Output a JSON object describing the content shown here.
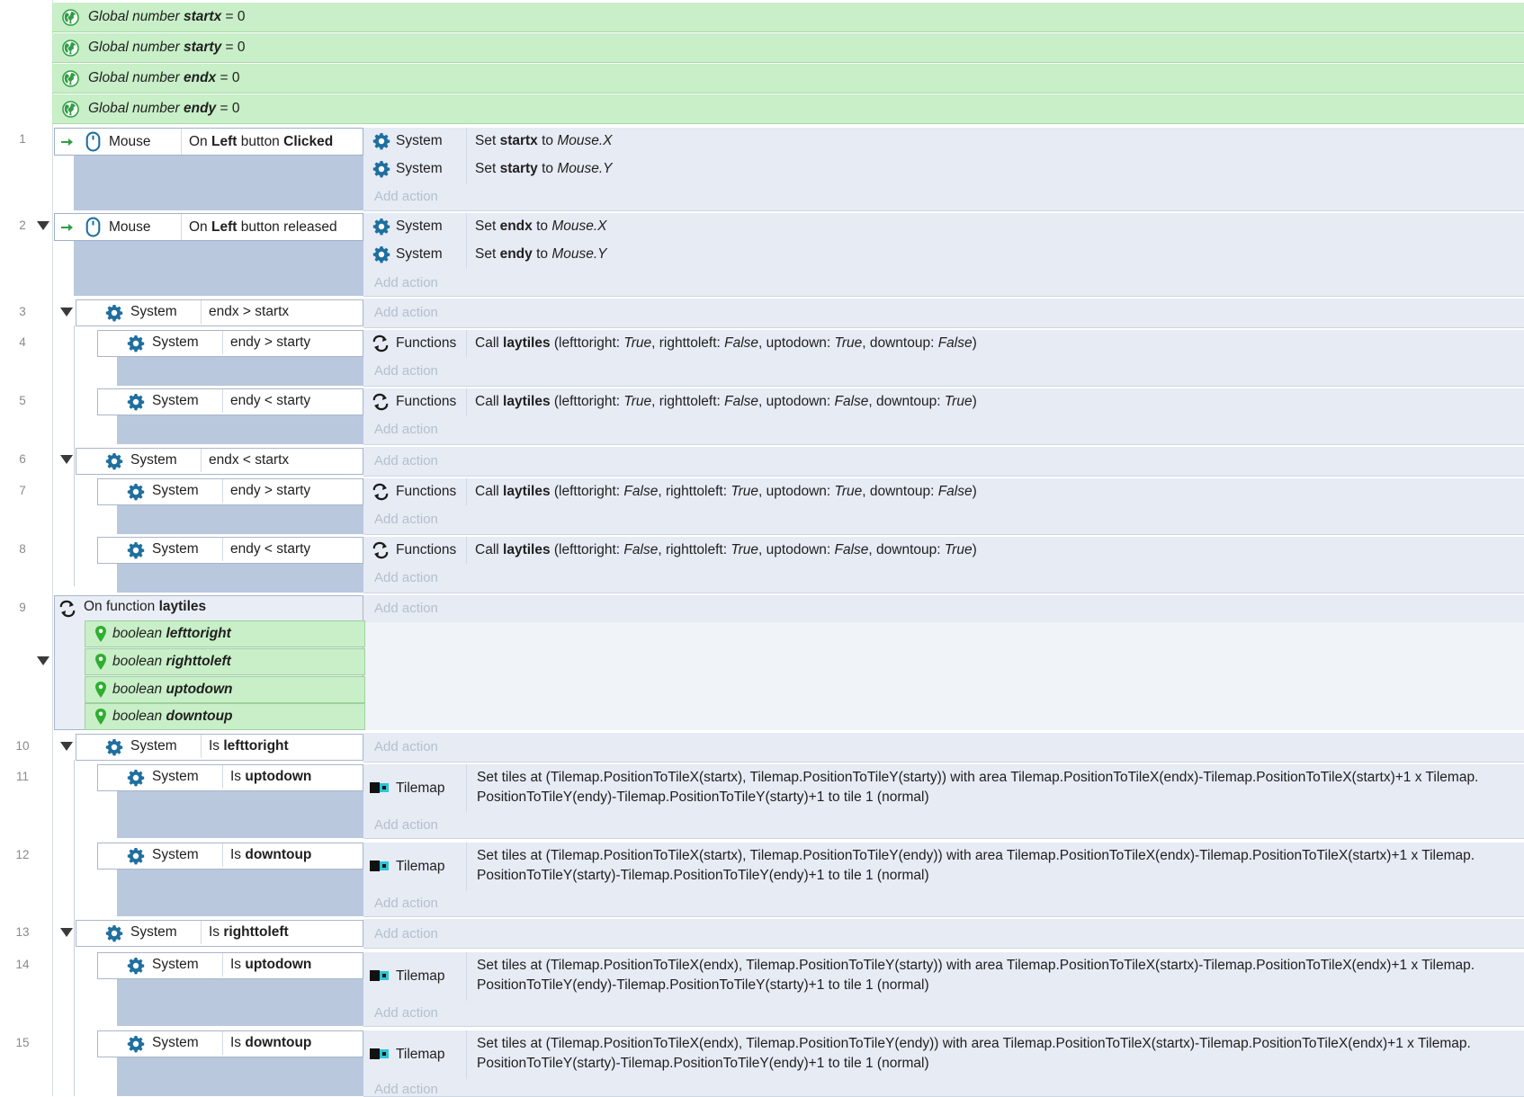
{
  "globals": [
    {
      "prefix": "Global number",
      "name": "startx",
      "value": "= 0"
    },
    {
      "prefix": "Global number",
      "name": "starty",
      "value": "= 0"
    },
    {
      "prefix": "Global number",
      "name": "endx",
      "value": "= 0"
    },
    {
      "prefix": "Global number",
      "name": "endy",
      "value": "= 0"
    }
  ],
  "labels": {
    "add_action": "Add action",
    "system": "System",
    "mouse": "Mouse",
    "functions": "Functions",
    "tilemap": "Tilemap"
  },
  "events": {
    "e1": {
      "num": "1",
      "cond_pre": "On ",
      "cond_b1": "Left",
      "cond_mid": " button ",
      "cond_b2": "Clicked",
      "a1_pre": "Set ",
      "a1_b": "startx",
      "a1_mid": " to ",
      "a1_i": "Mouse.X",
      "a2_pre": "Set ",
      "a2_b": "starty",
      "a2_mid": " to ",
      "a2_i": "Mouse.Y"
    },
    "e2": {
      "num": "2",
      "cond_pre": "On ",
      "cond_b1": "Left",
      "cond_mid": " button released",
      "a1_pre": "Set ",
      "a1_b": "endx",
      "a1_mid": " to ",
      "a1_i": "Mouse.X",
      "a2_pre": "Set ",
      "a2_b": "endy",
      "a2_mid": " to ",
      "a2_i": "Mouse.Y"
    },
    "e3": {
      "num": "3",
      "cond": "endx > startx"
    },
    "e4": {
      "num": "4",
      "cond": "endy > starty",
      "call": "Call ",
      "fn": "laytiles",
      "args": [
        [
          "(lefttoright: ",
          "True"
        ],
        [
          ", righttoleft: ",
          "False"
        ],
        [
          ", uptodown: ",
          "True"
        ],
        [
          ", downtoup: ",
          "False"
        ]
      ]
    },
    "e5": {
      "num": "5",
      "cond": "endy < starty",
      "call": "Call ",
      "fn": "laytiles",
      "args": [
        [
          "(lefttoright: ",
          "True"
        ],
        [
          ", righttoleft: ",
          "False"
        ],
        [
          ", uptodown: ",
          "False"
        ],
        [
          ", downtoup: ",
          "True"
        ]
      ]
    },
    "e6": {
      "num": "6",
      "cond": "endx < startx"
    },
    "e7": {
      "num": "7",
      "cond": "endy > starty",
      "call": "Call ",
      "fn": "laytiles",
      "args": [
        [
          "(lefttoright: ",
          "False"
        ],
        [
          ", righttoleft: ",
          "True"
        ],
        [
          ", uptodown: ",
          "True"
        ],
        [
          ", downtoup: ",
          "False"
        ]
      ]
    },
    "e8": {
      "num": "8",
      "cond": "endy < starty",
      "call": "Call ",
      "fn": "laytiles",
      "args": [
        [
          "(lefttoright: ",
          "False"
        ],
        [
          ", righttoleft: ",
          "True"
        ],
        [
          ", uptodown: ",
          "False"
        ],
        [
          ", downtoup: ",
          "True"
        ]
      ]
    },
    "e9": {
      "num": "9",
      "title_pre": "On function ",
      "title_b": "laytiles",
      "params": [
        {
          "type": "boolean",
          "name": "lefttoright"
        },
        {
          "type": "boolean",
          "name": "righttoleft"
        },
        {
          "type": "boolean",
          "name": "uptodown"
        },
        {
          "type": "boolean",
          "name": "downtoup"
        }
      ]
    },
    "e10": {
      "num": "10",
      "cond_pre": "Is ",
      "cond_b": "lefttoright"
    },
    "e11": {
      "num": "11",
      "cond_pre": "Is ",
      "cond_b": "uptodown",
      "line1": "Set tiles at (Tilemap.PositionToTileX(startx), Tilemap.PositionToTileY(starty)) with area Tilemap.PositionToTileX(endx)-Tilemap.PositionToTileX(startx)+1 x Tilemap.",
      "line2": "PositionToTileY(endy)-Tilemap.PositionToTileY(starty)+1 to tile 1 (normal)"
    },
    "e12": {
      "num": "12",
      "cond_pre": "Is ",
      "cond_b": "downtoup",
      "line1": "Set tiles at (Tilemap.PositionToTileX(startx), Tilemap.PositionToTileY(endy)) with area Tilemap.PositionToTileX(endx)-Tilemap.PositionToTileX(startx)+1 x Tilemap.",
      "line2": "PositionToTileY(starty)-Tilemap.PositionToTileY(endy)+1 to tile 1 (normal)"
    },
    "e13": {
      "num": "13",
      "cond_pre": "Is ",
      "cond_b": "righttoleft"
    },
    "e14": {
      "num": "14",
      "cond_pre": "Is ",
      "cond_b": "uptodown",
      "line1": "Set tiles at (Tilemap.PositionToTileX(endx), Tilemap.PositionToTileY(starty)) with area Tilemap.PositionToTileX(startx)-Tilemap.PositionToTileX(endx)+1 x Tilemap.",
      "line2": "PositionToTileY(endy)-Tilemap.PositionToTileY(starty)+1 to tile 1 (normal)"
    },
    "e15": {
      "num": "15",
      "cond_pre": "Is ",
      "cond_b": "downtoup",
      "line1": "Set tiles at (Tilemap.PositionToTileX(endx), Tilemap.PositionToTileY(endy)) with area Tilemap.PositionToTileX(startx)-Tilemap.PositionToTileX(endx)+1 x Tilemap.",
      "line2": "PositionToTileY(starty)-Tilemap.PositionToTileY(endy)+1 to tile 1 (normal)"
    }
  },
  "colors": {
    "accent": "#1f6f9f",
    "green": "#c8efc8",
    "action_bg": "#e6ebf4",
    "event_body": "#b9c8dd"
  }
}
